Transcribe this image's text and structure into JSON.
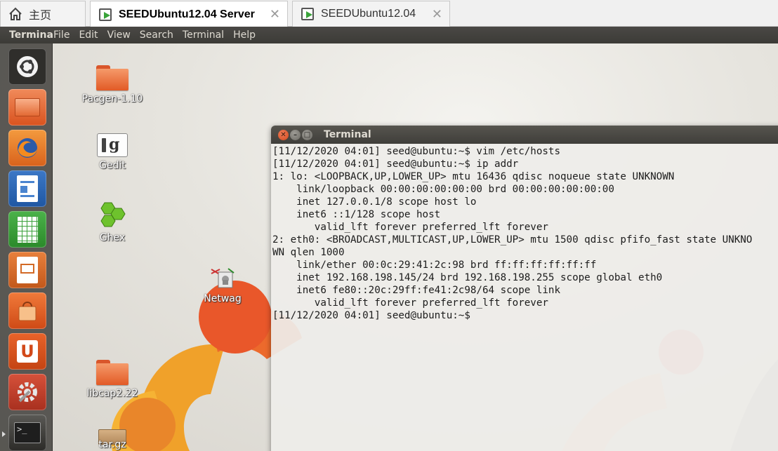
{
  "tabs": [
    {
      "label": "主页",
      "icon": "home-icon",
      "active": false
    },
    {
      "label": "SEEDUbuntu12.04 Server",
      "icon": "vm-icon",
      "active": true
    },
    {
      "label": "SEEDUbuntu12.04",
      "icon": "vm-icon",
      "active": false
    }
  ],
  "menubar": {
    "app_title": "Terminal",
    "items": [
      "File",
      "Edit",
      "View",
      "Search",
      "Terminal",
      "Help"
    ]
  },
  "desktop_icons": [
    {
      "label": "Pacgen-1.10",
      "icon": "folder-icon"
    },
    {
      "label": "Gedit",
      "icon": "gedit-icon"
    },
    {
      "label": "Ghex",
      "icon": "ghex-icon"
    },
    {
      "label": "Netwag",
      "icon": "netwag-icon"
    },
    {
      "label": "libcap2.22",
      "icon": "folder-icon"
    },
    {
      "label": "tar.gz",
      "icon": "archive-icon"
    }
  ],
  "launcher": [
    {
      "name": "dash-home",
      "icon": "ubuntu-logo-icon"
    },
    {
      "name": "files",
      "icon": "folder-icon"
    },
    {
      "name": "firefox",
      "icon": "firefox-icon"
    },
    {
      "name": "libreoffice-writer",
      "icon": "writer-icon"
    },
    {
      "name": "libreoffice-calc",
      "icon": "calc-icon"
    },
    {
      "name": "libreoffice-impress",
      "icon": "impress-icon"
    },
    {
      "name": "software-center",
      "icon": "shopping-bag-icon"
    },
    {
      "name": "ubuntu-one",
      "icon": "ubuntu-one-icon"
    },
    {
      "name": "system-settings",
      "icon": "settings-icon"
    },
    {
      "name": "terminal",
      "icon": "terminal-icon"
    }
  ],
  "terminal": {
    "title": "Terminal",
    "lines": [
      "[11/12/2020 04:01] seed@ubuntu:~$ vim /etc/hosts",
      "[11/12/2020 04:01] seed@ubuntu:~$ ip addr",
      "1: lo: <LOOPBACK,UP,LOWER_UP> mtu 16436 qdisc noqueue state UNKNOWN",
      "    link/loopback 00:00:00:00:00:00 brd 00:00:00:00:00:00",
      "    inet 127.0.0.1/8 scope host lo",
      "    inet6 ::1/128 scope host",
      "       valid_lft forever preferred_lft forever",
      "2: eth0: <BROADCAST,MULTICAST,UP,LOWER_UP> mtu 1500 qdisc pfifo_fast state UNKNO",
      "WN qlen 1000",
      "    link/ether 00:0c:29:41:2c:98 brd ff:ff:ff:ff:ff:ff",
      "    inet 192.168.198.145/24 brd 192.168.198.255 scope global eth0",
      "    inet6 fe80::20c:29ff:fe41:2c98/64 scope link",
      "       valid_lft forever preferred_lft forever",
      "[11/12/2020 04:01] seed@ubuntu:~$ "
    ]
  }
}
